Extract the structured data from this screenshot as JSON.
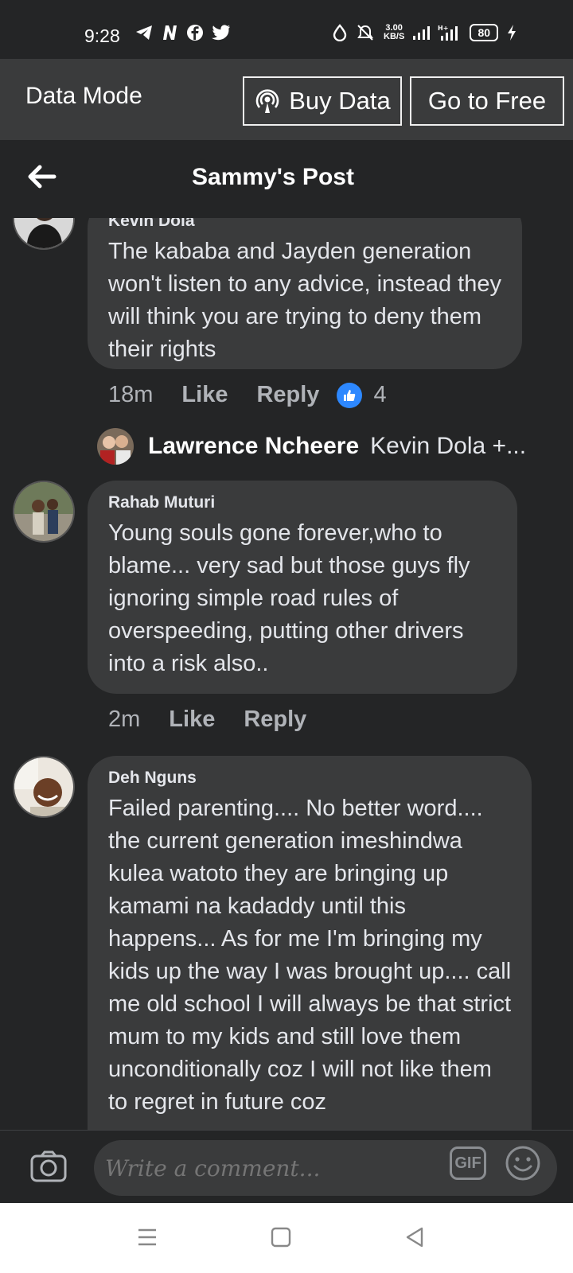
{
  "status_bar": {
    "time": "9:28",
    "speed_value": "3.00",
    "speed_unit": "KB/S",
    "battery": "80"
  },
  "data_bar": {
    "label": "Data Mode",
    "buy_data": "Buy Data",
    "go_free": "Go to Free"
  },
  "header": {
    "title": "Sammy's Post"
  },
  "comments": [
    {
      "author": "Kevin Dola",
      "text": "The kababa and Jayden generation won't listen to any advice, instead they will think you are trying to deny them their rights",
      "time": "18m",
      "like": "Like",
      "reply": "Reply",
      "reactions": "4"
    },
    {
      "author": "Rahab Muturi",
      "text": "Young souls gone forever,who to blame... very sad but those guys fly ignoring simple road rules of overspeeding, putting other drivers into  a risk also..",
      "time": "2m",
      "like": "Like",
      "reply": "Reply"
    },
    {
      "author": "Deh Nguns",
      "text": "Failed parenting.... No better word.... the current generation imeshindwa kulea watoto they are bringing up kamami na kadaddy until this happens... As for me I'm bringing my kids up the way I was brought up.... call me old school I will always be that strict mum to my kids and still love them unconditionally  coz I will not like them to regret in future coz"
    }
  ],
  "reply_preview": {
    "name": "Lawrence Ncheere",
    "text": "Kevin Dola +..."
  },
  "composer": {
    "placeholder": "Write a comment...",
    "gif": "GIF"
  },
  "colors": {
    "background": "#242526",
    "bubble": "#3a3b3c",
    "like_blue": "#2d88ff"
  }
}
